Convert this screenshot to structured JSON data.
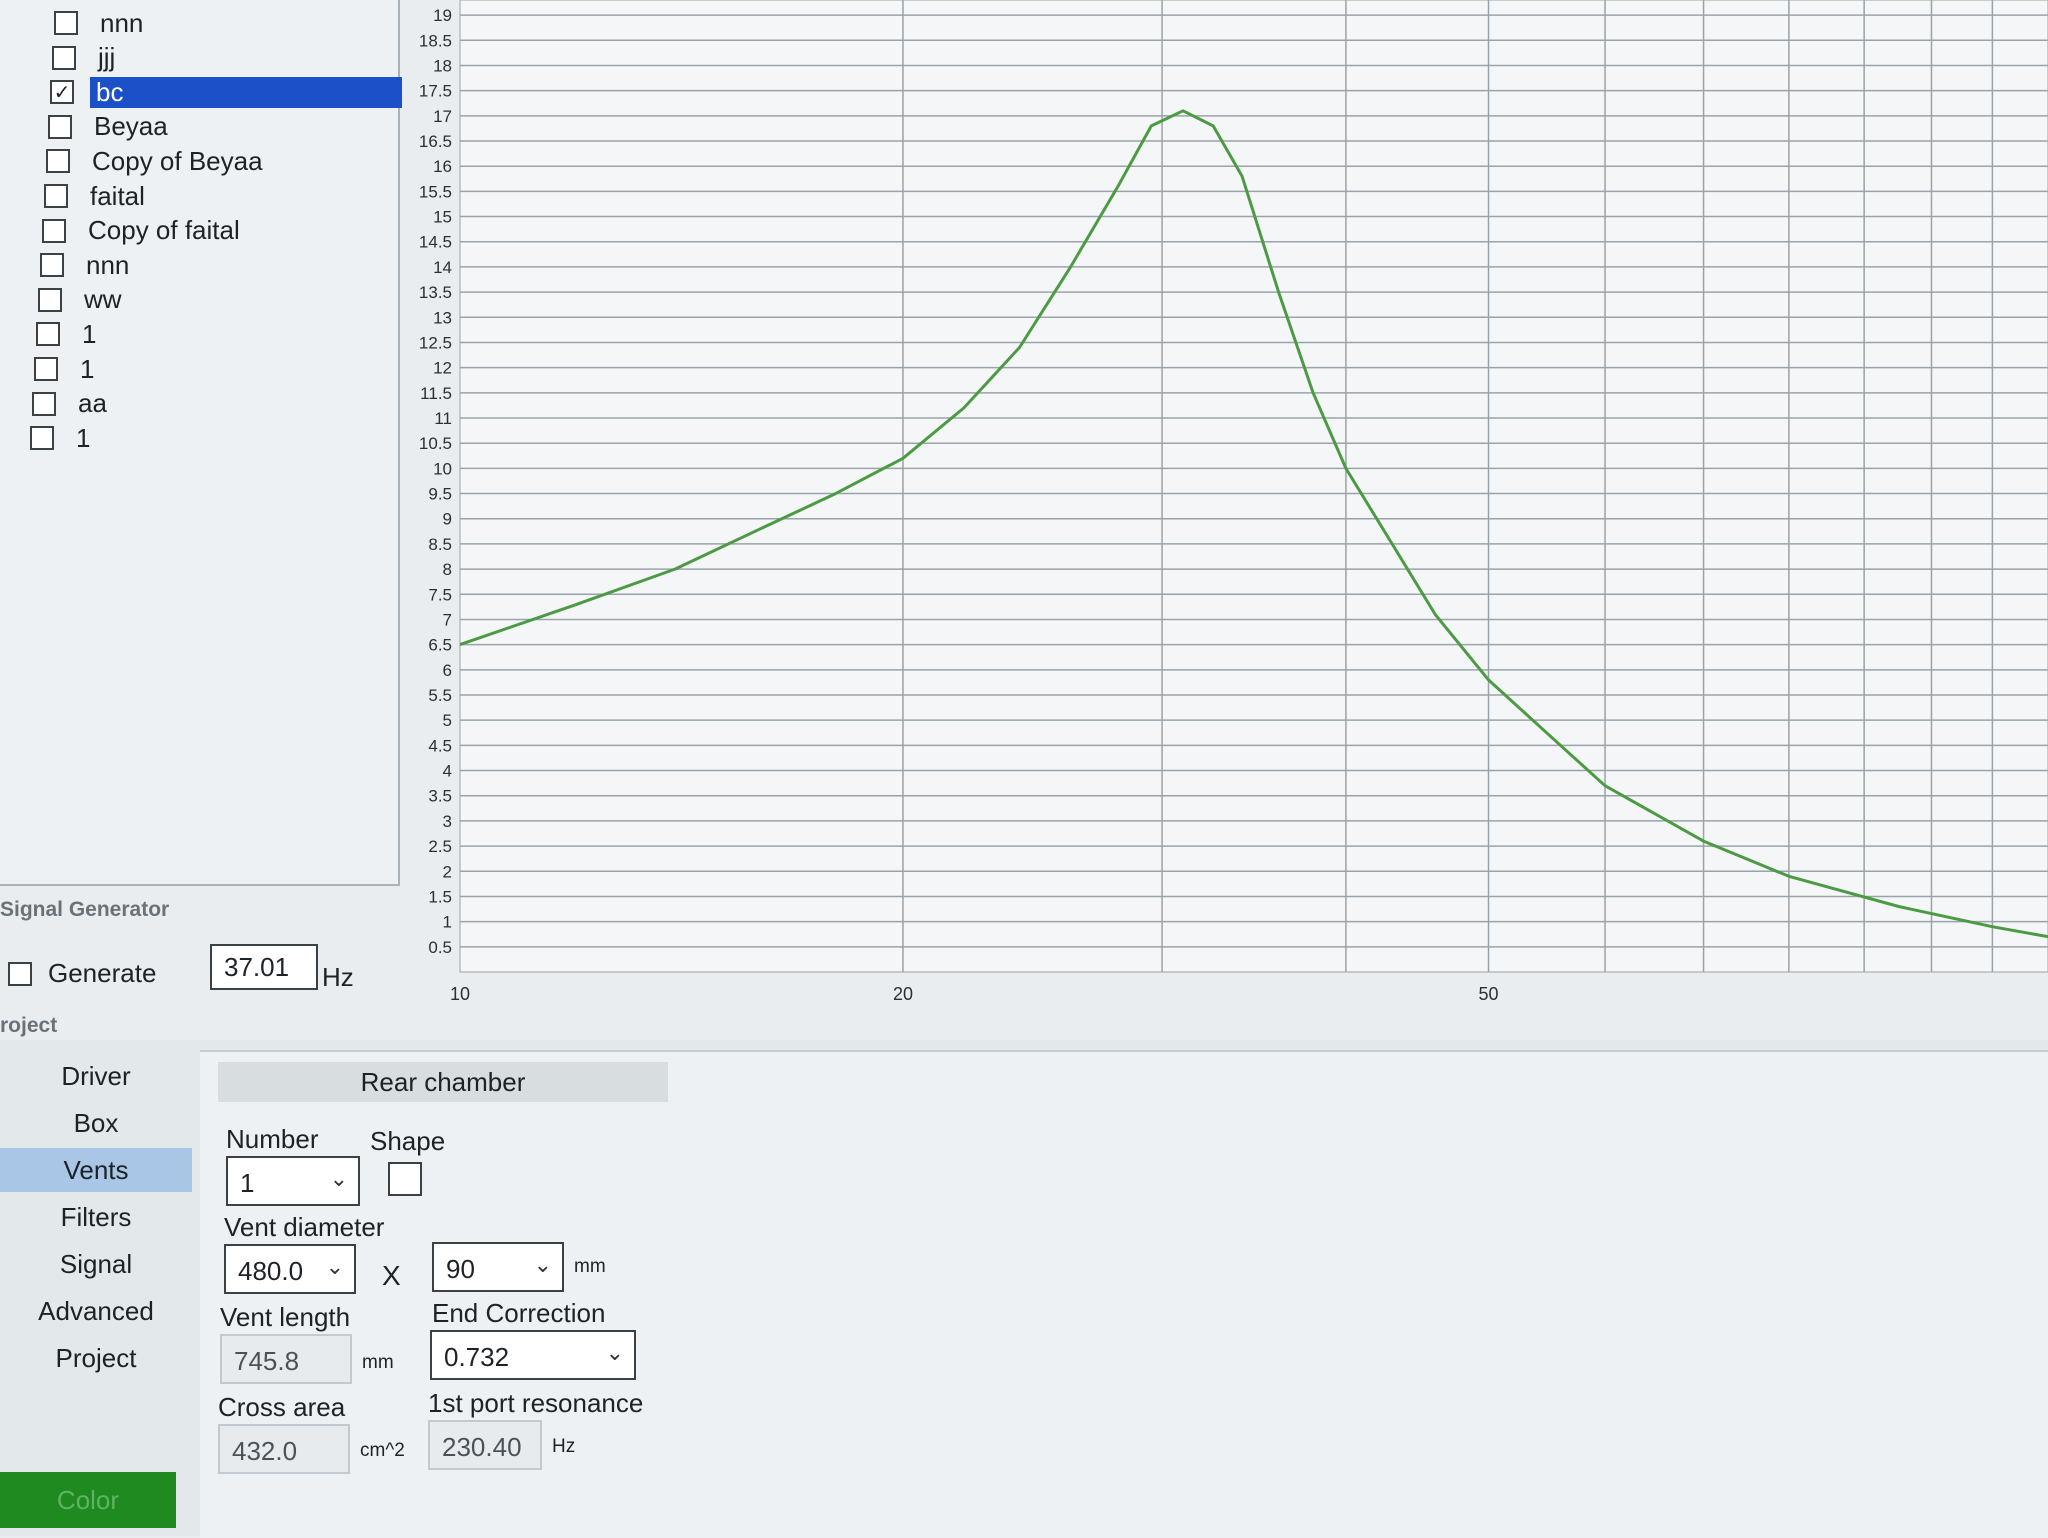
{
  "project_list": {
    "items": [
      {
        "label": "nnn",
        "checked": false
      },
      {
        "label": "jjj",
        "checked": false
      },
      {
        "label": "bc",
        "checked": true,
        "selected": true
      },
      {
        "label": "Beyaa",
        "checked": false
      },
      {
        "label": "Copy of Beyaa",
        "checked": false
      },
      {
        "label": "faital",
        "checked": false
      },
      {
        "label": "Copy of faital",
        "checked": false
      },
      {
        "label": "nnn",
        "checked": false
      },
      {
        "label": "ww",
        "checked": false
      },
      {
        "label": "1",
        "checked": false
      },
      {
        "label": "1",
        "checked": false
      },
      {
        "label": "aa",
        "checked": false
      },
      {
        "label": "1",
        "checked": false
      }
    ]
  },
  "chart_data": {
    "type": "line",
    "x_scale": "log",
    "xlim": [
      10,
      120
    ],
    "ylim": [
      0,
      19.3
    ],
    "ylabel_ticks": [
      "0.5",
      "1",
      "1.5",
      "2",
      "2.5",
      "3",
      "3.5",
      "4",
      "4.5",
      "5",
      "5.5",
      "6",
      "6.5",
      "7",
      "7.5",
      "8",
      "8.5",
      "9",
      "9.5",
      "10",
      "10.5",
      "11",
      "11.5",
      "12",
      "12.5",
      "13",
      "13.5",
      "14",
      "14.5",
      "15",
      "15.5",
      "16",
      "16.5",
      "17",
      "17.5",
      "18",
      "18.5",
      "19"
    ],
    "xlabel_ticks": [
      "10",
      "20",
      "50"
    ],
    "grid": true,
    "series": [
      {
        "color": "#4d9a45",
        "points": [
          [
            10,
            6.5
          ],
          [
            12,
            7.3
          ],
          [
            14,
            8.0
          ],
          [
            16,
            8.8
          ],
          [
            18,
            9.5
          ],
          [
            20,
            10.2
          ],
          [
            22,
            11.2
          ],
          [
            24,
            12.4
          ],
          [
            26,
            14.0
          ],
          [
            28,
            15.6
          ],
          [
            29.5,
            16.8
          ],
          [
            31,
            17.1
          ],
          [
            32.5,
            16.8
          ],
          [
            34,
            15.8
          ],
          [
            36,
            13.5
          ],
          [
            38,
            11.5
          ],
          [
            40,
            10.0
          ],
          [
            43,
            8.5
          ],
          [
            46,
            7.1
          ],
          [
            50,
            5.8
          ],
          [
            55,
            4.7
          ],
          [
            60,
            3.7
          ],
          [
            70,
            2.6
          ],
          [
            80,
            1.9
          ],
          [
            95,
            1.3
          ],
          [
            110,
            0.9
          ],
          [
            120,
            0.7
          ]
        ]
      }
    ]
  },
  "signal_generator": {
    "title": "Signal Generator",
    "generate_label": "Generate",
    "generate_checked": false,
    "frequency": "37.01",
    "frequency_unit": "Hz"
  },
  "project_panel": {
    "title": "roject",
    "nav": [
      "Driver",
      "Box",
      "Vents",
      "Filters",
      "Signal",
      "Advanced",
      "Project"
    ],
    "active_nav": "Vents",
    "color_button": "Color"
  },
  "vents": {
    "tab_title": "Rear chamber",
    "number_label": "Number",
    "number_value": "1",
    "shape_label": "Shape",
    "vent_diameter_label": "Vent diameter",
    "vent_diameter_value": "480.0",
    "times": "X",
    "vent_second_value": "90",
    "vent_unit": "mm",
    "vent_length_label": "Vent length",
    "vent_length_value": "745.8",
    "vent_length_unit": "mm",
    "end_correction_label": "End Correction",
    "end_correction_value": "0.732",
    "cross_area_label": "Cross area",
    "cross_area_value": "432.0",
    "cross_area_unit": "cm^2",
    "port_resonance_label": "1st port resonance",
    "port_resonance_value": "230.40",
    "port_resonance_unit": "Hz"
  },
  "colors": {
    "selection": "#1c50c8",
    "active_nav": "#a9c6e6",
    "color_button": "#1f8a1f",
    "curve": "#4d9a45"
  }
}
